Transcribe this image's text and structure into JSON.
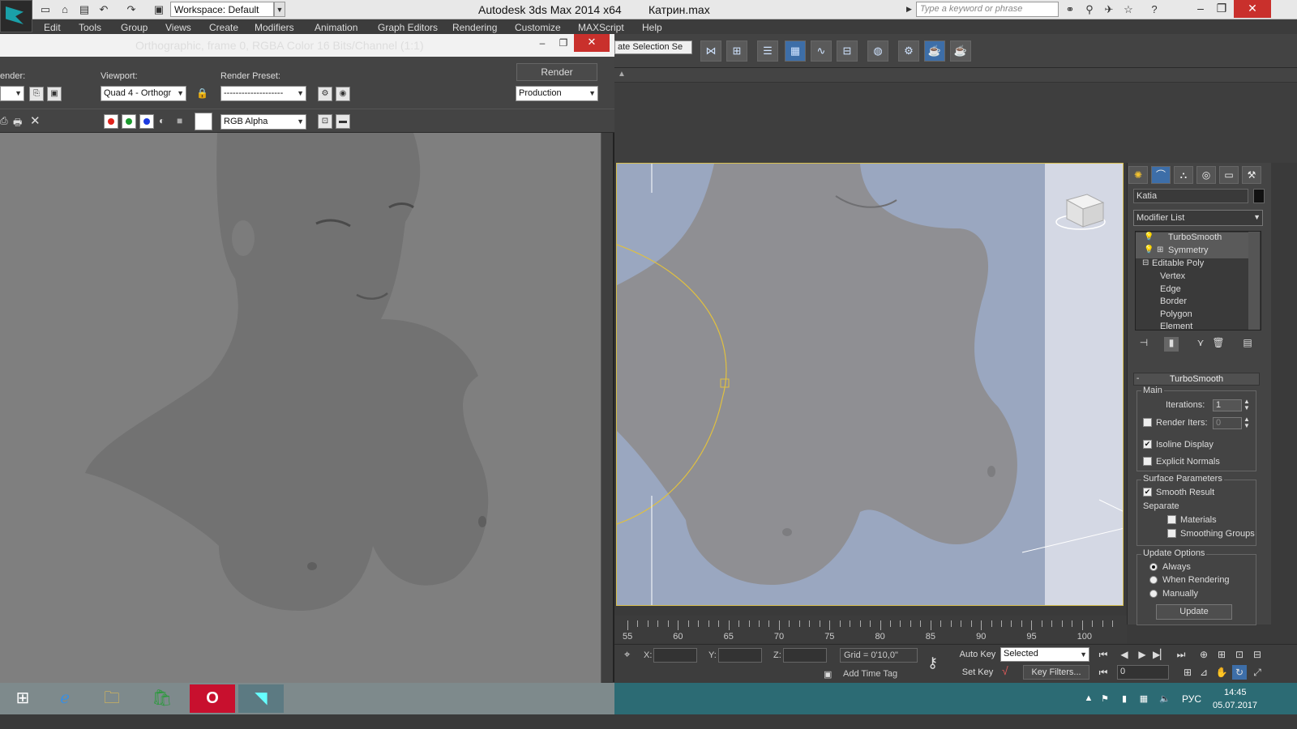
{
  "titlebar": {
    "workspace": "Workspace: Default",
    "app_title": "Autodesk 3ds Max  2014 x64",
    "file_title": "Катрин.max",
    "search_placeholder": "Type a keyword or phrase"
  },
  "menu": [
    "Edit",
    "Tools",
    "Group",
    "Views",
    "Create",
    "Modifiers",
    "Animation",
    "Graph Editors",
    "Rendering",
    "Customize",
    "MAXScript",
    "Help"
  ],
  "main_toolbar": {
    "selection_set": "ate Selection Se"
  },
  "render_frame": {
    "title": "Orthographic, frame 0, RGBA Color 16 Bits/Channel (1:1)",
    "area_label": "ender:",
    "viewport_label": "Viewport:",
    "viewport_value": "Quad 4 - Orthogr",
    "preset_label": "Render Preset:",
    "preset_value": "--------------------",
    "render_button": "Render",
    "production_value": "Production",
    "channel_value": "RGB Alpha",
    "channel_colors": {
      "red": "#e0231c",
      "green": "#1b9a2e",
      "blue": "#1c3be0"
    }
  },
  "command_panel": {
    "object_name": "Katia",
    "object_color": "#111111",
    "modifier_list": "Modifier List",
    "stack": [
      {
        "label": "TurboSmooth",
        "selected": true
      },
      {
        "label": "Symmetry",
        "selected": true
      },
      {
        "label": "Editable Poly",
        "selected": false
      },
      {
        "label": "Vertex",
        "selected": false
      },
      {
        "label": "Edge",
        "selected": false
      },
      {
        "label": "Border",
        "selected": false
      },
      {
        "label": "Polygon",
        "selected": false
      },
      {
        "label": "Element",
        "selected": false
      }
    ],
    "turbosmooth": {
      "header": "TurboSmooth",
      "main_label": "Main",
      "iterations_label": "Iterations:",
      "iterations_value": "1",
      "render_iters_label": "Render Iters:",
      "render_iters_value": "0",
      "render_iters_checked": false,
      "isoline_label": "Isoline Display",
      "isoline_checked": true,
      "explicit_label": "Explicit Normals",
      "explicit_checked": false,
      "surface_label": "Surface Parameters",
      "smooth_result_label": "Smooth Result",
      "smooth_result_checked": true,
      "separate_label": "Separate",
      "materials_label": "Materials",
      "materials_checked": false,
      "smoothing_groups_label": "Smoothing Groups",
      "smoothing_groups_checked": false,
      "update_options_label": "Update Options",
      "always_label": "Always",
      "when_rendering_label": "When Rendering",
      "manually_label": "Manually",
      "update_mode": "Always",
      "update_button": "Update"
    }
  },
  "timeline": {
    "labels": [
      "55",
      "60",
      "65",
      "70",
      "75",
      "80",
      "85",
      "90",
      "95",
      "100"
    ]
  },
  "statusbar": {
    "x_label": "X:",
    "y_label": "Y:",
    "z_label": "Z:",
    "grid": "Grid = 0'10,0\"",
    "add_time_tag": "Add Time Tag",
    "auto_key": "Auto Key",
    "set_key": "Set Key",
    "selected": "Selected",
    "key_filters": "Key Filters...",
    "frame": "0"
  },
  "taskbar": {
    "lang": "РУС",
    "time": "14:45",
    "date": "05.07.2017"
  }
}
